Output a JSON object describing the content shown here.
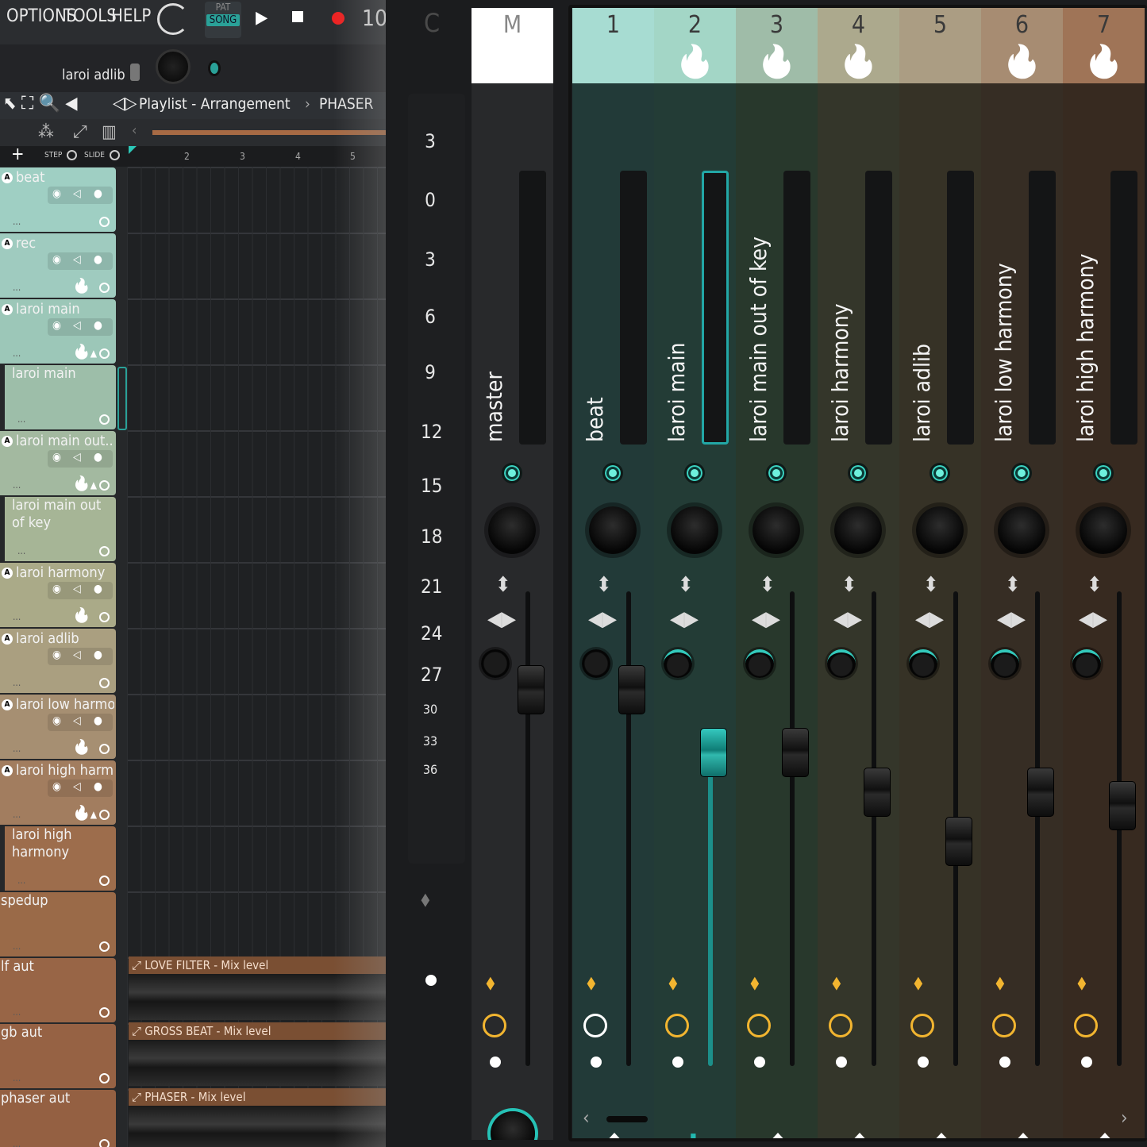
{
  "menu": {
    "options": "OPTIONS",
    "tools": "TOOLS",
    "help": "HELP",
    "pat": "PAT",
    "song": "SONG",
    "tempo": "10"
  },
  "hint_text": "laroi adlib",
  "playlist": {
    "title": "Playlist - Arrangement",
    "separator": "›",
    "pattern": "PHASER",
    "step": "STEP",
    "slide": "SLIDE",
    "add": "+"
  },
  "ruler": [
    "2",
    "3",
    "4",
    "5"
  ],
  "tracks": [
    {
      "name": "beat",
      "icon": "A",
      "color": "#9fcfc3",
      "flame": false,
      "up": false
    },
    {
      "name": "rec",
      "icon": "A",
      "color": "#9fcbbf",
      "flame": true,
      "up": false
    },
    {
      "name": "laroi main",
      "icon": "A",
      "color": "#9cc7b8",
      "flame": true,
      "up": true
    },
    {
      "name": "laroi main",
      "icon": "",
      "color": "#9dbea9",
      "flame": false,
      "up": false
    },
    {
      "name": "laroi main out..",
      "icon": "A",
      "color": "#a3b9a0",
      "flame": true,
      "up": true
    },
    {
      "name": "laroi main out of key",
      "icon": "",
      "color": "#a6b596",
      "flame": false,
      "up": false
    },
    {
      "name": "laroi harmony",
      "icon": "A",
      "color": "#aaaa88",
      "flame": true,
      "up": false
    },
    {
      "name": "laroi adlib",
      "icon": "A",
      "color": "#aa9f80",
      "flame": false,
      "up": false
    },
    {
      "name": "laroi low harmo..",
      "icon": "A",
      "color": "#a68f72",
      "flame": true,
      "up": false
    },
    {
      "name": "laroi high harm..",
      "icon": "A",
      "color": "#a27d5f",
      "flame": true,
      "up": true
    },
    {
      "name": "laroi high harmony",
      "icon": "",
      "color": "#9d6d4c",
      "flame": false,
      "up": false
    },
    {
      "name": "spedup",
      "icon": "",
      "color": "#9a6a48",
      "flame": false,
      "up": false
    },
    {
      "name": "lf aut",
      "icon": "",
      "color": "#986546",
      "flame": false,
      "up": false
    },
    {
      "name": "gb aut",
      "icon": "",
      "color": "#966244",
      "flame": false,
      "up": false
    },
    {
      "name": "phaser aut",
      "icon": "",
      "color": "#946042",
      "flame": false,
      "up": false
    }
  ],
  "clips": [
    "LOVE FILTER - Mix level",
    "GROSS BEAT - Mix level",
    "PHASER - Mix level"
  ],
  "mixer": {
    "current_label": "C",
    "scale": [
      "3",
      "0",
      "3",
      "6",
      "9",
      "12",
      "15",
      "18",
      "21",
      "24",
      "27",
      "30",
      "33",
      "36"
    ],
    "master": {
      "num": "M",
      "label": "master"
    },
    "channels": [
      {
        "num": "1",
        "label": "beat",
        "head": "#a7dcd2",
        "body": "#223a38",
        "flame": false,
        "fader": 0.78,
        "selected": false
      },
      {
        "num": "2",
        "label": "laroi main",
        "head": "#a3d6c6",
        "body": "#233c36",
        "flame": true,
        "fader": 0.64,
        "selected": true
      },
      {
        "num": "3",
        "label": "laroi main out of key",
        "head": "#9fbca8",
        "body": "#28382c",
        "flame": true,
        "fader": 0.64,
        "selected": false
      },
      {
        "num": "4",
        "label": "laroi harmony",
        "head": "#aca98d",
        "body": "#34362a",
        "flame": true,
        "fader": 0.55,
        "selected": false
      },
      {
        "num": "5",
        "label": "laroi adlib",
        "head": "#ab9d83",
        "body": "#363226",
        "flame": false,
        "fader": 0.44,
        "selected": false
      },
      {
        "num": "6",
        "label": "laroi low harmony",
        "head": "#a78c72",
        "body": "#362d24",
        "flame": true,
        "fader": 0.55,
        "selected": false
      },
      {
        "num": "7",
        "label": "laroi high harmony",
        "head": "#9f7457",
        "body": "#372a20",
        "flame": true,
        "fader": 0.52,
        "selected": false
      }
    ]
  }
}
